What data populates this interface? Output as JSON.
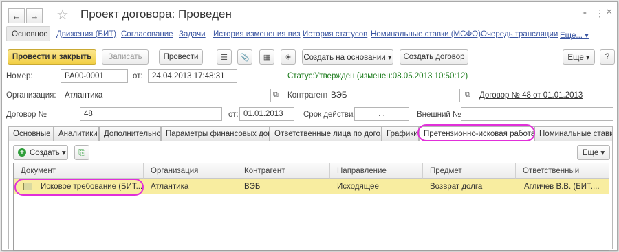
{
  "window": {
    "title": "Проект договора: Проведен",
    "back_icon": "←",
    "forward_icon": "→",
    "star_icon": "☆",
    "link_icon": "🔗",
    "more_icon": "⋮",
    "close_icon": "×"
  },
  "nav": {
    "items": [
      "Основное",
      "Движения (БИТ)",
      "Согласование",
      "Задачи",
      "История изменения виз",
      "История статусов",
      "Номинальные ставки (МСФО)",
      "Очередь трансляции",
      "Еще... ▾"
    ]
  },
  "toolbar": {
    "post_close": "Провести и закрыть",
    "save": "Записать",
    "post": "Провести",
    "create_based": "Создать на основании ▾",
    "create_contract": "Создать договор",
    "more": "Еще ▾",
    "help": "?"
  },
  "fields": {
    "number_label": "Номер:",
    "number_value": "РА00-0001",
    "from_label": "от:",
    "from_value": "24.04.2013 17:48:31",
    "status_label": "Статус:",
    "status_value": "Утвержден (изменен:08.05.2013 10:50:12)",
    "org_label": "Организация:",
    "org_value": "Атлантика",
    "contractor_label": "Контрагент:",
    "contractor_value": "ВЭБ",
    "contract_link": "Договор № 48 от 01.01.2013",
    "contract_label": "Договор №",
    "contract_value": "48",
    "contract_from_label": "от:",
    "contract_from_value": "01.01.2013",
    "validity_label": "Срок действия:",
    "validity_value": ". .",
    "external_label": "Внешний №:",
    "external_value": ""
  },
  "tabs": [
    "Основные",
    "Аналитики",
    "Дополнительно",
    "Параметры финансовых дог...",
    "Ответственные лица по дого...",
    "Графики",
    "Претензионно-исковая работа",
    "Номинальные ставки"
  ],
  "panel": {
    "create": "Создать ▾",
    "more": "Еще ▾"
  },
  "table": {
    "columns": [
      "Документ",
      "Организация",
      "Контрагент",
      "Направление",
      "Предмет",
      "Ответственный"
    ],
    "rows": [
      [
        "Исковое требование (БИТ...",
        "Атлантика",
        "ВЭБ",
        "Исходящее",
        "Возврат долга",
        "Агличев В.В. (БИТ...."
      ]
    ]
  },
  "colors": {
    "accent_link": "#3a55a1",
    "status_green": "#1a7a1a",
    "highlight_oval": "#e12fd9",
    "selected_row": "#f8eda0",
    "primary_button": "#f2cf45"
  }
}
